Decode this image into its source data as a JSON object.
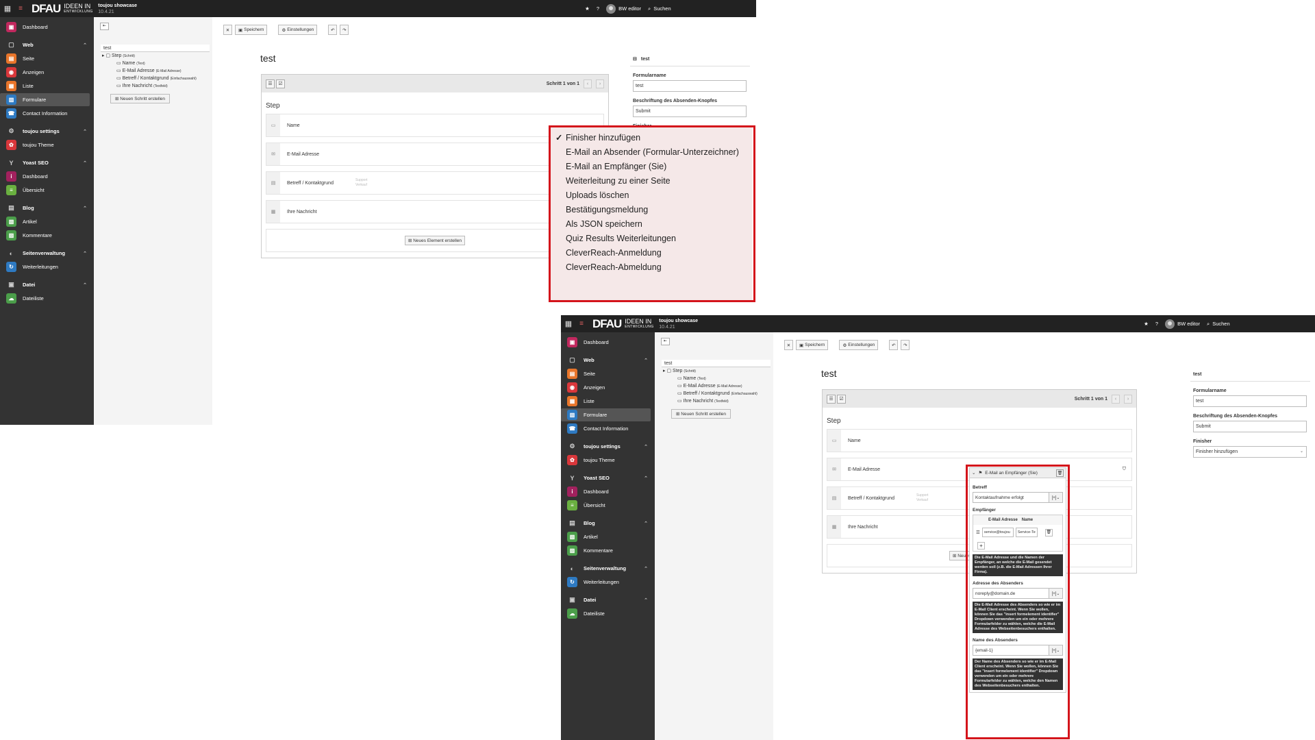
{
  "topbar": {
    "logo": "DFAU",
    "logo_sub1": "IDEEN IN",
    "logo_sub2": "ENTWICKLUNG",
    "site_name": "toujou showcase",
    "version": "10.4.21",
    "user": "BW editor",
    "search": "Suchen"
  },
  "sidebar": {
    "items": [
      {
        "type": "item",
        "label": "Dashboard",
        "color": "#c1285e",
        "glyph": "▣"
      },
      {
        "type": "group",
        "label": "Web",
        "glyph": "▢"
      },
      {
        "type": "item",
        "label": "Seite",
        "color": "#e8752a",
        "glyph": "▤"
      },
      {
        "type": "item",
        "label": "Anzeigen",
        "color": "#d9373b",
        "glyph": "◉"
      },
      {
        "type": "item",
        "label": "Liste",
        "color": "#e8752a",
        "glyph": "▦"
      },
      {
        "type": "item",
        "label": "Formulare",
        "color": "#2e7ac2",
        "glyph": "▥",
        "active": true
      },
      {
        "type": "item",
        "label": "Contact Information",
        "color": "#2e7ac2",
        "glyph": "☎"
      },
      {
        "type": "group",
        "label": "toujou settings",
        "glyph": "⚙"
      },
      {
        "type": "item",
        "label": "toujou Theme",
        "color": "#d9373b",
        "glyph": "✿"
      },
      {
        "type": "group",
        "label": "Yoast SEO",
        "glyph": "Y"
      },
      {
        "type": "item",
        "label": "Dashboard",
        "color": "#a2215e",
        "glyph": "i"
      },
      {
        "type": "item",
        "label": "Übersicht",
        "color": "#6ab040",
        "glyph": "≡"
      },
      {
        "type": "group",
        "label": "Blog",
        "glyph": "▤"
      },
      {
        "type": "item",
        "label": "Artikel",
        "color": "#4b9e4a",
        "glyph": "▧"
      },
      {
        "type": "item",
        "label": "Kommentare",
        "color": "#4b9e4a",
        "glyph": "▨"
      },
      {
        "type": "group",
        "label": "Seitenverwaltung",
        "glyph": "◐"
      },
      {
        "type": "item",
        "label": "Weiterleitungen",
        "color": "#2e7ac2",
        "glyph": "↻"
      },
      {
        "type": "group",
        "label": "Datei",
        "glyph": "▣"
      },
      {
        "type": "item",
        "label": "Dateiliste",
        "color": "#4b9e4a",
        "glyph": "☁"
      }
    ]
  },
  "tree": {
    "root": "test",
    "step": "Step",
    "step_type": "(Schritt)",
    "children": [
      {
        "label": "Name",
        "type": "(Text)"
      },
      {
        "label": "E-Mail Adresse",
        "type": "(E-Mail Adresse)"
      },
      {
        "label": "Betreff / Kontaktgrund",
        "type": "(Einfachauswahl)"
      },
      {
        "label": "Ihre Nachricht",
        "type": "(Textfeld)"
      }
    ],
    "new_step": "Neuen Schritt erstellen"
  },
  "toolbar": {
    "save": "Speichern",
    "settings": "Einstellungen"
  },
  "form": {
    "title": "test",
    "pagination": "Schritt 1 von 1",
    "step_name": "Step",
    "elements": [
      {
        "label": "Name",
        "opt1": "",
        "opt2": ""
      },
      {
        "label": "E-Mail Adresse",
        "opt1": "",
        "opt2": ""
      },
      {
        "label": "Betreff / Kontaktgrund",
        "opt1": "Support",
        "opt2": "Verkauf"
      },
      {
        "label": "Ihre Nachricht",
        "opt1": "",
        "opt2": ""
      }
    ],
    "new_element": "Neues Element erstellen"
  },
  "inspector": {
    "title": "test",
    "form_name_label": "Formularname",
    "form_name_value": "test",
    "submit_label": "Beschriftung des Absenden-Knopfes",
    "submit_value": "Submit",
    "finisher_label": "Finisher",
    "finisher_value": "Finisher hinzufügen"
  },
  "dropdown": {
    "options": [
      "Finisher hinzufügen",
      "E-Mail an Absender (Formular-Unterzeichner)",
      "E-Mail an Empfänger (Sie)",
      "Weiterleitung zu einer Seite",
      "Uploads löschen",
      "Bestätigungsmeldung",
      "Als JSON speichern",
      "Quiz Results Weiterleitungen",
      "CleverReach-Anmeldung",
      "CleverReach-Abmeldung"
    ],
    "selected_mark": "✓"
  },
  "finisher_panel": {
    "title": "E-Mail an Empfänger (Sie)",
    "betreff_label": "Betreff",
    "betreff_value": "Kontaktaufnahme erfolgt",
    "empfaenger_label": "Empfänger",
    "col_email": "E-Mail Adresse",
    "col_name": "Name",
    "row_email": "service@toujou",
    "row_name": "Service-Te",
    "help1": "Die E-Mail Adresse und die Namen der Empfänger, an welche die E-Mail gesendet werden soll (z.B. die E-Mail Adressen Ihrer Firma).",
    "sender_addr_label": "Adresse des Absenders",
    "sender_addr_value": "noreply@domain.de",
    "help2": "Die E-Mail Adresse des Absenders so wie er im E-Mail Client erscheint. Wenn Sie wollen, können Sie das \"insert formelement identifier\" Dropdown verwenden um ein oder mehrere Formularfelder zu wählen, welche die E-Mail Adresse des Webseitenbesuchers enthalten.",
    "sender_name_label": "Name des Absenders",
    "sender_name_value": "{email-1}",
    "help3": "Der Name des Absenders so wie er im E-Mail Client erscheint. Wenn Sie wollen, können Sie das \"insert formelement identifier\" Dropdown verwenden um ein oder mehrere Formularfelder zu wählen, welche den Namen des Webseitenbesuchers enthalten."
  }
}
